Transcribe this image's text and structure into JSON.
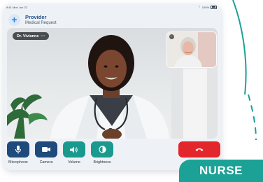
{
  "status_bar": {
    "time": "9:41  Mon Jun 22",
    "signal": "100%"
  },
  "header": {
    "title": "Provider",
    "subtitle": "Medical Request"
  },
  "video": {
    "caller_name": "Dr. Vivianne",
    "caller_menu": "···"
  },
  "controls": [
    {
      "label": "Microphone",
      "icon": "microphone-icon"
    },
    {
      "label": "Camera",
      "icon": "camera-icon"
    },
    {
      "label": "Volume",
      "icon": "volume-icon"
    },
    {
      "label": "Brightness",
      "icon": "brightness-icon"
    }
  ],
  "end_call": {
    "icon": "hang-up-icon"
  },
  "role_badge": {
    "label": "NURSE"
  },
  "colors": {
    "navy": "#1f4a7c",
    "teal": "#1a9a8f",
    "end_call_red": "#e3262c",
    "badge_teal": "#1ca196",
    "brand_blue": "#1e4d8a"
  }
}
